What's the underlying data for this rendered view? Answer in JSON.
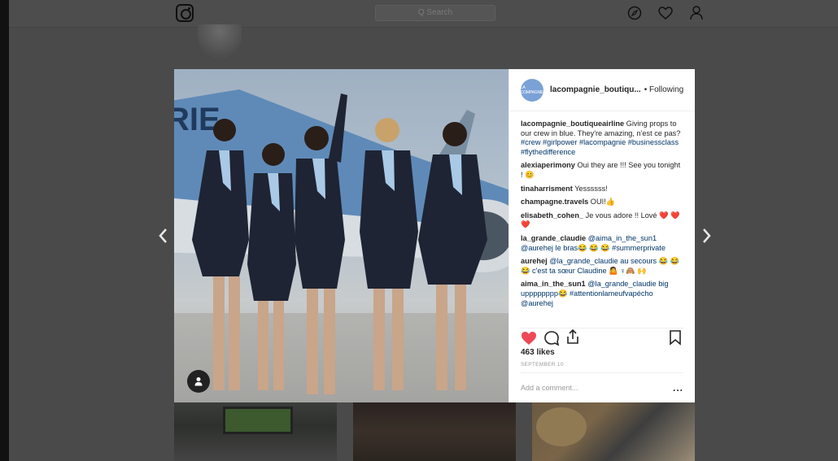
{
  "header": {
    "search_placeholder": "Q Search"
  },
  "icons": [
    "instagram-logo-icon",
    "compass-icon",
    "heart-icon",
    "person-icon"
  ],
  "post": {
    "username_short": "lacompagnie_boutiqu...",
    "follow_status": "• Following",
    "avatar_text": "LA COMPAGNIE",
    "caption": {
      "user": "lacompagnie_boutiqueairline",
      "text": " Giving props to our crew in blue. They're amazing, n'est ce pas? ",
      "tags": "#crew #girlpower #lacompagnie #businessclass #flythedifference"
    },
    "comments": [
      {
        "user": "alexiaperimony",
        "text": " Oui they are !!! See you tonight ! 😊",
        "hl": ""
      },
      {
        "user": "tinaharrisment",
        "text": " Yessssss!",
        "hl": ""
      },
      {
        "user": "champagne.travels",
        "text": " OUI!👍",
        "hl": ""
      },
      {
        "user": "elisabeth_cohen_",
        "text": " Je vous adore !! Lové ❤️ ❤️ ❤️",
        "hl": ""
      },
      {
        "user": "la_grande_claudie",
        "text": "",
        "hl": " @aima_in_the_sun1 @aurehej le bras😂 😂 😂 #summerprivate"
      },
      {
        "user": "aurehej",
        "text": "",
        "hl": " @la_grande_claudie au secours 😂 😂 😂 c'est ta sœur Claudine 🤷 ♀🙈 🙌"
      },
      {
        "user": "aima_in_the_sun1",
        "text": "",
        "hl": " @la_grande_claudie big upppppppp😂 #attentionlameufvapécho @aurehej"
      }
    ],
    "likes": "463 likes",
    "date": "SEPTEMBER 10",
    "add_comment_placeholder": "Add a comment...",
    "more": "..."
  },
  "colors": {
    "like": "#ed4956",
    "link": "#003569",
    "text": "#262626"
  }
}
